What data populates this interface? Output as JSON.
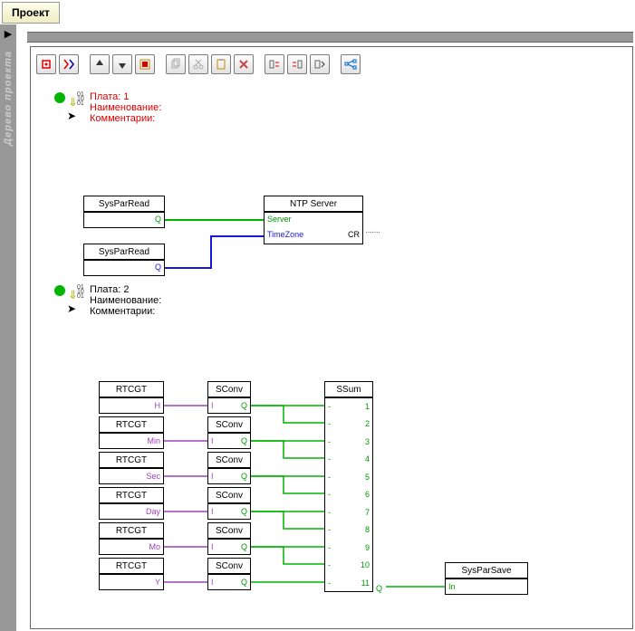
{
  "tab": "Проект",
  "sidebar_label": "Дерево проекта",
  "group1": {
    "title": "Плата: 1",
    "name_label": "Наименование:",
    "comm_label": "Комментарии:"
  },
  "group2": {
    "title": "Плата: 2",
    "name_label": "Наименование:",
    "comm_label": "Комментарии:"
  },
  "b": {
    "spr1": "SysParRead",
    "spr2": "SysParRead",
    "ntp": "NTP Server",
    "ntp_p1": "Server",
    "ntp_p2": "TimeZone",
    "ntp_cr": "CR",
    "q": "Q",
    "rtc": "RTCGT",
    "sconv": "SConv",
    "ssum": "SSum",
    "spsave": "SysParSave",
    "h": "H",
    "min": "Min",
    "sec": "Sec",
    "day": "Day",
    "mo": "Mo",
    "y": "Y",
    "i": "I",
    "in": "In",
    "dash": "-",
    "n1": "1",
    "n2": "2",
    "n3": "3",
    "n4": "4",
    "n5": "5",
    "n6": "6",
    "n7": "7",
    "n8": "8",
    "n9": "9",
    "n10": "10",
    "n11": "11"
  }
}
